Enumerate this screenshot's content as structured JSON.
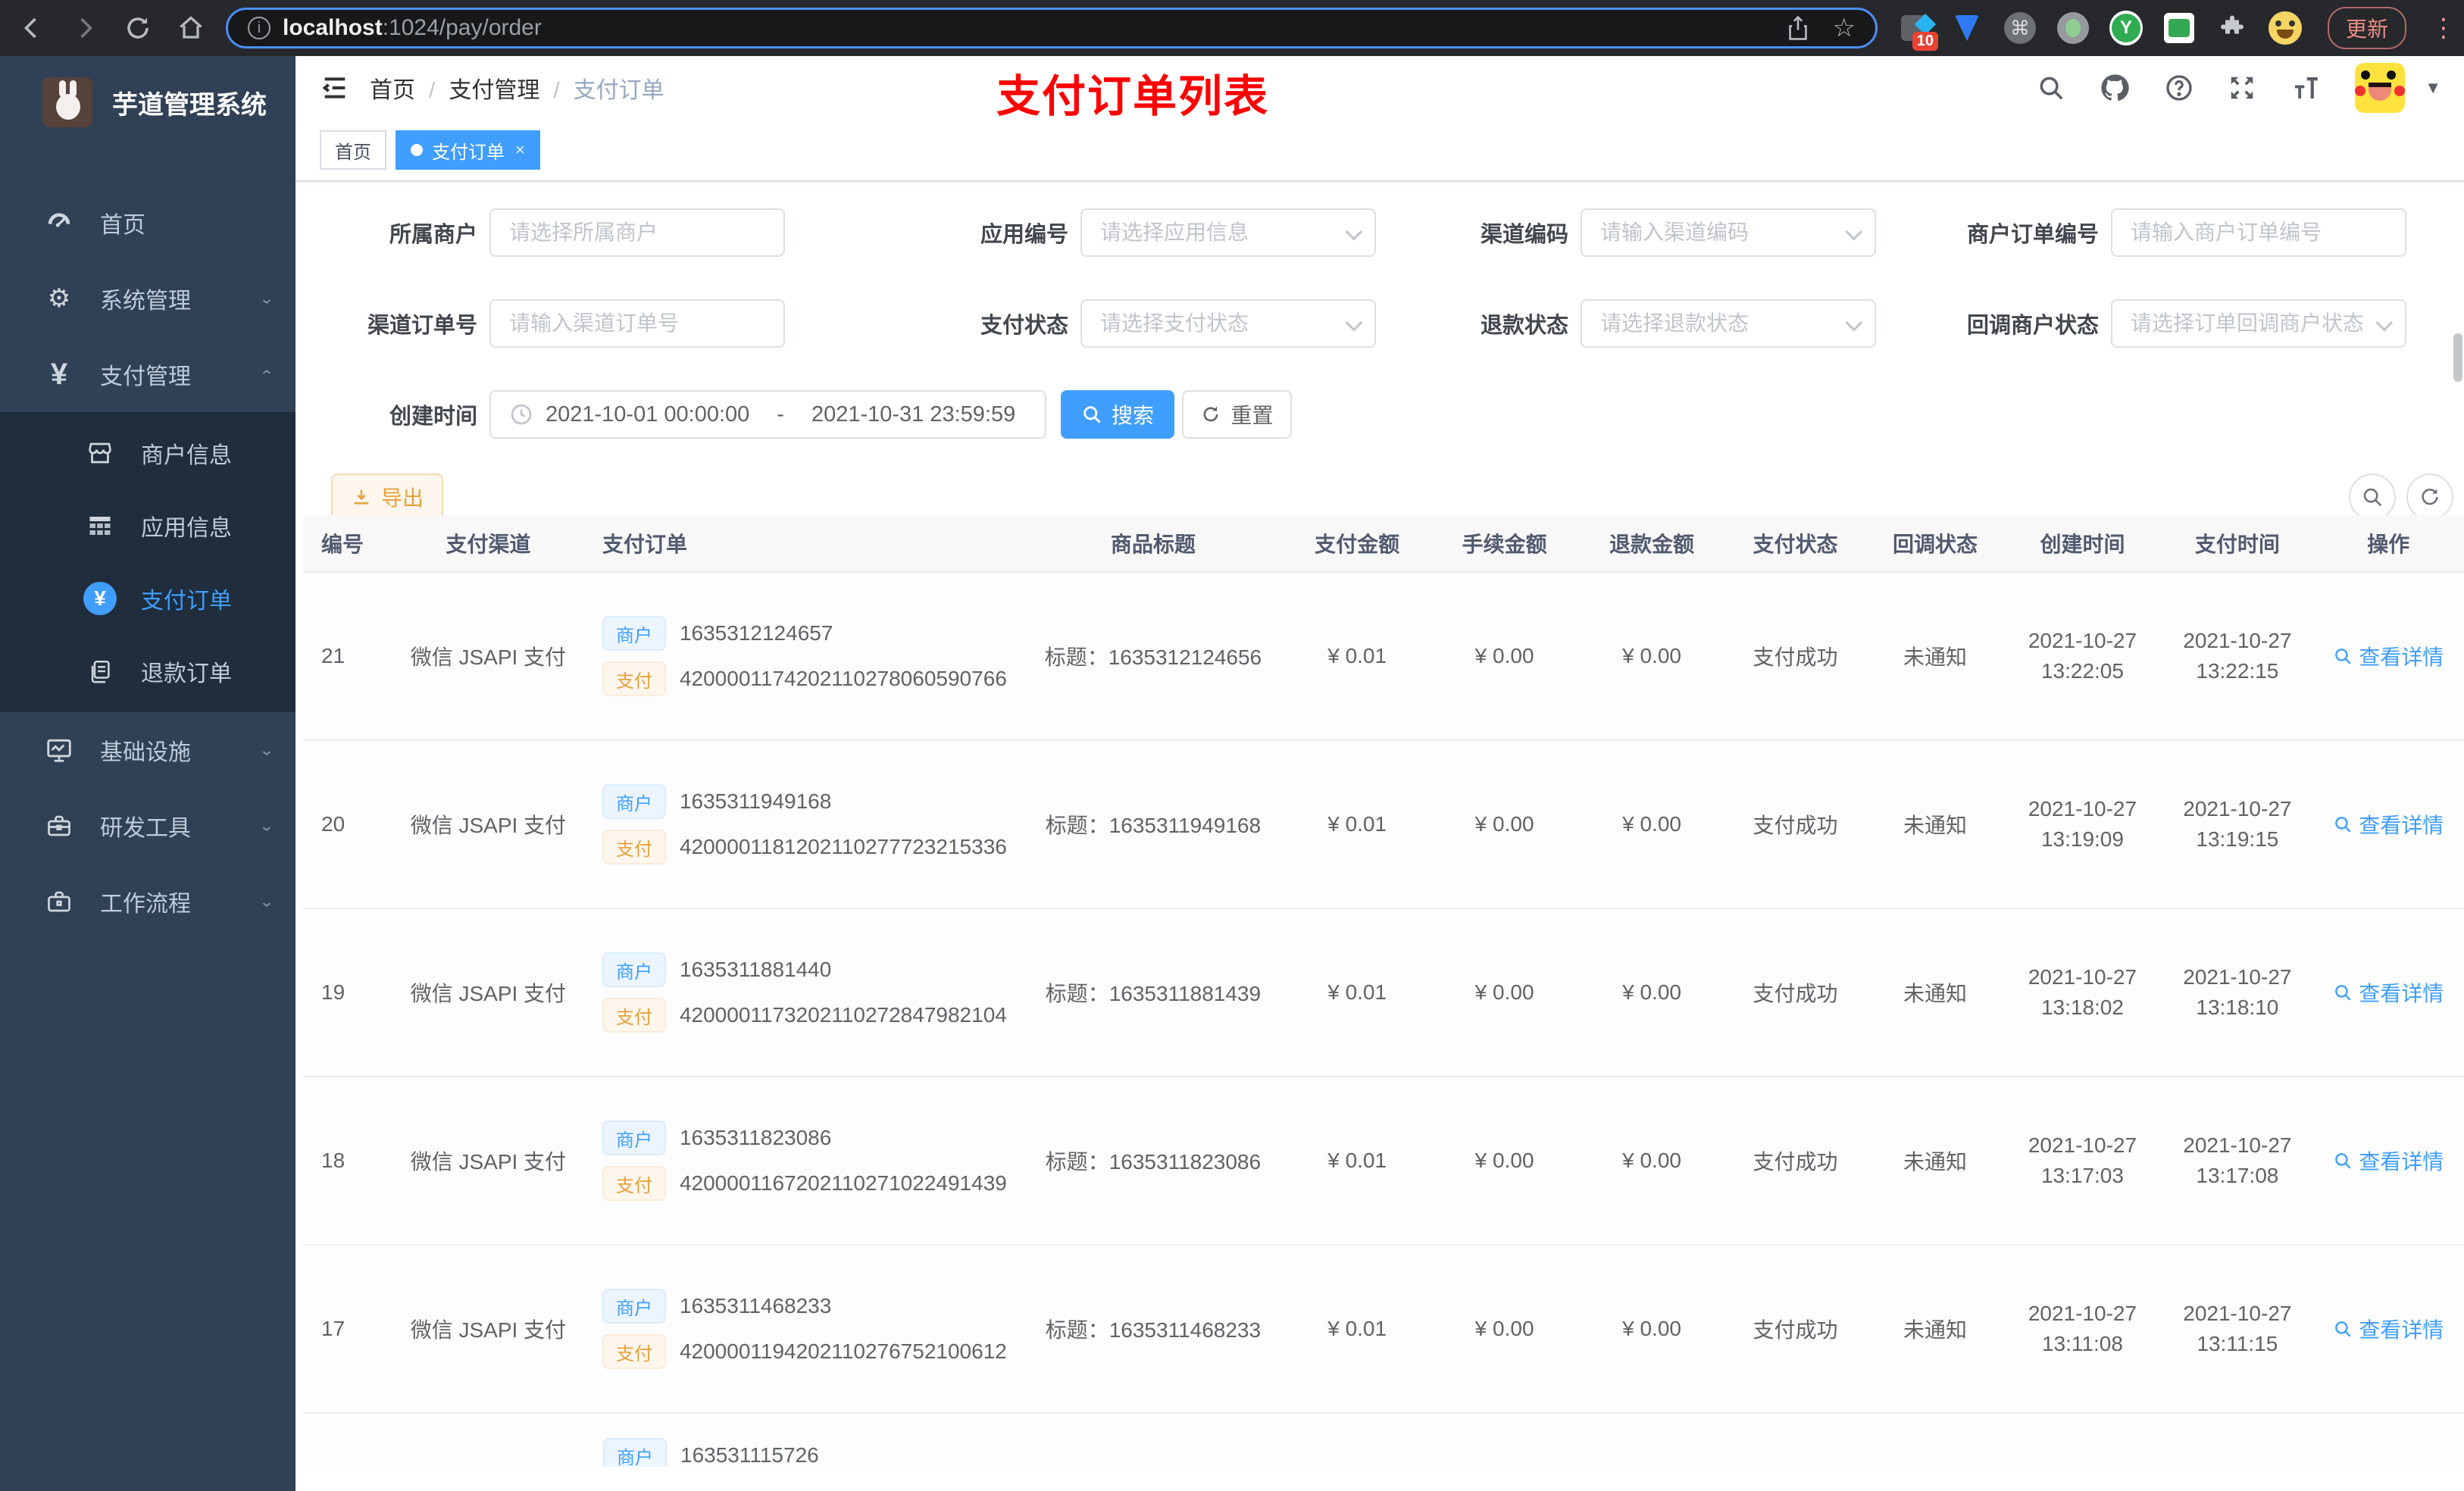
{
  "browser": {
    "url_host": "localhost",
    "url_path": ":1024/pay/order",
    "ext_badge": "10",
    "ext_y": "Y",
    "command_glyph": "⌘",
    "update_label": "更新"
  },
  "sidebar": {
    "app_title": "芋道管理系统",
    "items": [
      {
        "label": "首页"
      },
      {
        "label": "系统管理"
      },
      {
        "label": "支付管理"
      },
      {
        "label": "商户信息"
      },
      {
        "label": "应用信息"
      },
      {
        "label": "支付订单"
      },
      {
        "label": "退款订单"
      },
      {
        "label": "基础设施"
      },
      {
        "label": "研发工具"
      },
      {
        "label": "工作流程"
      }
    ]
  },
  "header": {
    "breadcrumb": [
      "首页",
      "支付管理",
      "支付订单"
    ],
    "overlay_title": "支付订单列表"
  },
  "tags": [
    {
      "label": "首页"
    },
    {
      "label": "支付订单"
    }
  ],
  "filters": {
    "fields": [
      {
        "label": "所属商户",
        "placeholder": "请选择所属商户"
      },
      {
        "label": "应用编号",
        "placeholder": "请选择应用信息"
      },
      {
        "label": "渠道编码",
        "placeholder": "请输入渠道编码"
      },
      {
        "label": "商户订单编号",
        "placeholder": "请输入商户订单编号"
      },
      {
        "label": "渠道订单号",
        "placeholder": "请输入渠道订单号"
      },
      {
        "label": "支付状态",
        "placeholder": "请选择支付状态"
      },
      {
        "label": "退款状态",
        "placeholder": "请选择退款状态"
      },
      {
        "label": "回调商户状态",
        "placeholder": "请选择订单回调商户状态"
      }
    ],
    "create_time_label": "创建时间",
    "date_start": "2021-10-01 00:00:00",
    "date_separator": "-",
    "date_end": "2021-10-31 23:59:59",
    "search_label": "搜索",
    "reset_label": "重置"
  },
  "toolbar": {
    "export_label": "导出"
  },
  "table": {
    "tag_merchant": "商户",
    "tag_pay": "支付",
    "headers": [
      "编号",
      "支付渠道",
      "支付订单",
      "商品标题",
      "支付金额",
      "手续金额",
      "退款金额",
      "支付状态",
      "回调状态",
      "创建时间",
      "支付时间",
      "操作"
    ],
    "rows": [
      {
        "id": "21",
        "channel": "微信 JSAPI 支付",
        "merchant_no": "1635312124657",
        "pay_no": "4200001174202110278060590766",
        "title": "标题：1635312124656",
        "amount": "¥ 0.01",
        "fee": "¥ 0.00",
        "refund": "¥ 0.00",
        "status": "支付成功",
        "notify": "未通知",
        "create_time": "2021-10-27 13:22:05",
        "pay_time": "2021-10-27 13:22:15",
        "action": "查看详情"
      },
      {
        "id": "20",
        "channel": "微信 JSAPI 支付",
        "merchant_no": "1635311949168",
        "pay_no": "4200001181202110277723215336",
        "title": "标题：1635311949168",
        "amount": "¥ 0.01",
        "fee": "¥ 0.00",
        "refund": "¥ 0.00",
        "status": "支付成功",
        "notify": "未通知",
        "create_time": "2021-10-27 13:19:09",
        "pay_time": "2021-10-27 13:19:15",
        "action": "查看详情"
      },
      {
        "id": "19",
        "channel": "微信 JSAPI 支付",
        "merchant_no": "1635311881440",
        "pay_no": "4200001173202110272847982104",
        "title": "标题：1635311881439",
        "amount": "¥ 0.01",
        "fee": "¥ 0.00",
        "refund": "¥ 0.00",
        "status": "支付成功",
        "notify": "未通知",
        "create_time": "2021-10-27 13:18:02",
        "pay_time": "2021-10-27 13:18:10",
        "action": "查看详情"
      },
      {
        "id": "18",
        "channel": "微信 JSAPI 支付",
        "merchant_no": "1635311823086",
        "pay_no": "4200001167202110271022491439",
        "title": "标题：1635311823086",
        "amount": "¥ 0.01",
        "fee": "¥ 0.00",
        "refund": "¥ 0.00",
        "status": "支付成功",
        "notify": "未通知",
        "create_time": "2021-10-27 13:17:03",
        "pay_time": "2021-10-27 13:17:08",
        "action": "查看详情"
      },
      {
        "id": "17",
        "channel": "微信 JSAPI 支付",
        "merchant_no": "1635311468233",
        "pay_no": "4200001194202110276752100612",
        "title": "标题：1635311468233",
        "amount": "¥ 0.01",
        "fee": "¥ 0.00",
        "refund": "¥ 0.00",
        "status": "支付成功",
        "notify": "未通知",
        "create_time": "2021-10-27 13:11:08",
        "pay_time": "2021-10-27 13:11:15",
        "action": "查看详情"
      }
    ],
    "partial_row": {
      "merchant_no": "163531115726"
    }
  }
}
